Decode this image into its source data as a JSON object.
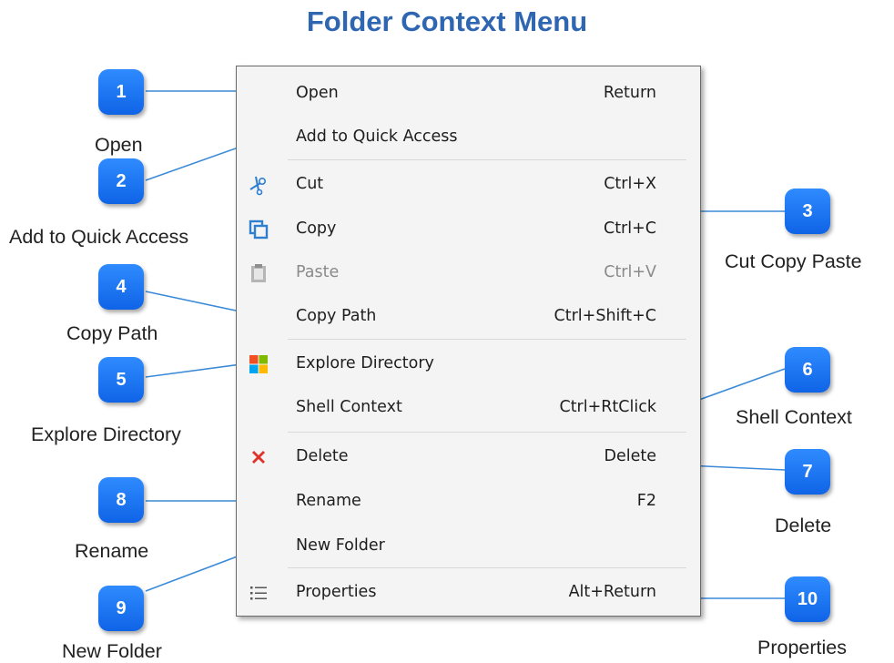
{
  "title": "Folder Context Menu",
  "accent_color": "#2f66b1",
  "badge_color": "#1877f2",
  "callout_line_color": "#3b8ad8",
  "menu": {
    "items": [
      {
        "label": "Open",
        "shortcut": "Return",
        "icon": "",
        "enabled": true
      },
      {
        "label": "Add to Quick Access",
        "shortcut": "",
        "icon": "",
        "enabled": true
      },
      {
        "label": "Cut",
        "shortcut": "Ctrl+X",
        "icon": "scissors-icon",
        "enabled": true
      },
      {
        "label": "Copy",
        "shortcut": "Ctrl+C",
        "icon": "copy-icon",
        "enabled": true
      },
      {
        "label": "Paste",
        "shortcut": "Ctrl+V",
        "icon": "clipboard-icon",
        "enabled": false
      },
      {
        "label": "Copy Path",
        "shortcut": "Ctrl+Shift+C",
        "icon": "",
        "enabled": true
      },
      {
        "label": "Explore Directory",
        "shortcut": "",
        "icon": "windows-icon",
        "enabled": true
      },
      {
        "label": "Shell Context",
        "shortcut": "Ctrl+RtClick",
        "icon": "",
        "enabled": true
      },
      {
        "label": "Delete",
        "shortcut": "Delete",
        "icon": "delete-x-icon",
        "enabled": true
      },
      {
        "label": "Rename",
        "shortcut": "F2",
        "icon": "",
        "enabled": true
      },
      {
        "label": "New Folder",
        "shortcut": "",
        "icon": "",
        "enabled": true
      },
      {
        "label": "Properties",
        "shortcut": "Alt+Return",
        "icon": "list-icon",
        "enabled": true
      }
    ]
  },
  "callouts": [
    {
      "number": "1",
      "caption": "Open"
    },
    {
      "number": "2",
      "caption": "Add to Quick Access"
    },
    {
      "number": "3",
      "caption": "Cut Copy Paste"
    },
    {
      "number": "4",
      "caption": "Copy Path"
    },
    {
      "number": "5",
      "caption": "Explore Directory"
    },
    {
      "number": "6",
      "caption": "Shell Context"
    },
    {
      "number": "7",
      "caption": "Delete"
    },
    {
      "number": "8",
      "caption": "Rename"
    },
    {
      "number": "9",
      "caption": "New Folder"
    },
    {
      "number": "10",
      "caption": "Properties"
    }
  ]
}
